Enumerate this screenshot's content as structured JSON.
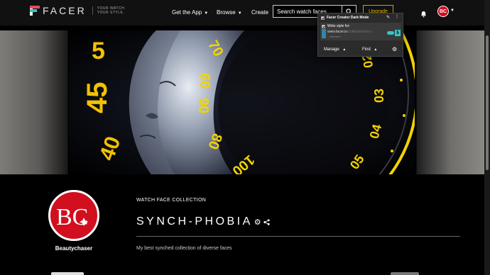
{
  "header": {
    "logo_text": "FACER",
    "logo_tagline_line1": "YOUR WATCH.",
    "logo_tagline_line2": "YOUR STYLE.",
    "nav": [
      {
        "label": "Get the App"
      },
      {
        "label": "Browse"
      },
      {
        "label": "Create"
      }
    ],
    "search_placeholder": "Search watch faces",
    "upgrade_label": "Upgrade",
    "avatar_initials": "BC"
  },
  "extension_popup": {
    "title": "Facer Creator Dark Mode",
    "write_style_label": "Write style for:",
    "url_prefix": "www.facer.io",
    "url_suffix": "/collections/s-y-...",
    "theme_text": "—#theme+",
    "count": "5",
    "manage_label": "Manage",
    "find_label": "Find"
  },
  "banner": {
    "numerals_left": [
      "5",
      "45",
      "40"
    ],
    "numerals_inner": [
      "70",
      "60",
      "90",
      "80",
      "100"
    ],
    "numerals_right": [
      "02",
      "03",
      "04",
      "05"
    ]
  },
  "collection": {
    "type_label": "WATCH FACE COLLECTION",
    "title": "SYNCH-PHOBIA",
    "description": "My best synched collection of diverse faces",
    "author_name": "Beautychaser",
    "author_initials": "BC"
  },
  "colors": {
    "accent_yellow": "#f2c200",
    "avatar_red": "#d10f1e",
    "teal": "#35c4c9",
    "pink": "#e34c65"
  }
}
